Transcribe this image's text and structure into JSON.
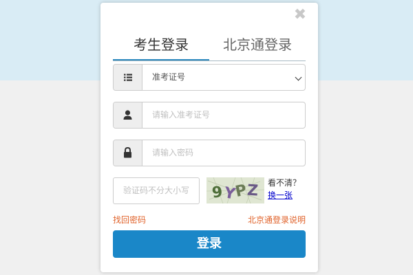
{
  "modal": {
    "close_glyph": "✖",
    "close_icon": "close-icon"
  },
  "tabs": [
    {
      "label": "考生登录",
      "active": true
    },
    {
      "label": "北京通登录",
      "active": false
    }
  ],
  "form": {
    "id_type": {
      "icon": "list-icon",
      "selected": "准考证号"
    },
    "username": {
      "icon": "user-icon",
      "placeholder": "请输入准考证号"
    },
    "password": {
      "icon": "lock-icon",
      "placeholder": "请输入密码"
    },
    "captcha": {
      "placeholder": "验证码不分大小写",
      "image_text": "9YPZ",
      "help_text": "看不清？",
      "refresh_link": "换一张"
    }
  },
  "links": {
    "forgot_password": "找回密码",
    "beijingtong_help": "北京通登录说明"
  },
  "login_button": "登录",
  "colors": {
    "accent": "#1a87c8",
    "link_orange": "#e0622a",
    "page_top_band": "#d9ecf5"
  }
}
